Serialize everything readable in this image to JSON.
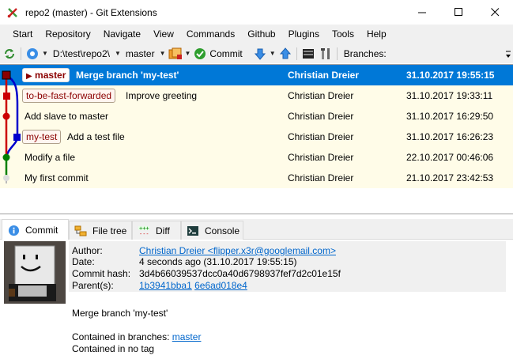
{
  "window": {
    "title": "repo2 (master) - Git Extensions"
  },
  "menu": [
    "Start",
    "Repository",
    "Navigate",
    "View",
    "Commands",
    "Github",
    "Plugins",
    "Tools",
    "Help"
  ],
  "toolbar": {
    "repo_path": "D:\\test\\repo2\\",
    "branch": "master",
    "commit_label": "Commit",
    "branches_label": "Branches:"
  },
  "commits": [
    {
      "ref": "master",
      "message": "Merge branch 'my-test'",
      "author": "Christian Dreier",
      "date": "31.10.2017 19:55:15"
    },
    {
      "ref": "to-be-fast-forwarded",
      "message": "Improve greeting",
      "author": "Christian Dreier",
      "date": "31.10.2017 19:33:11"
    },
    {
      "ref": "",
      "message": "Add slave to master",
      "author": "Christian Dreier",
      "date": "31.10.2017 16:29:50"
    },
    {
      "ref": "my-test",
      "message": "Add a test file",
      "author": "Christian Dreier",
      "date": "31.10.2017 16:26:23"
    },
    {
      "ref": "",
      "message": "Modify a file",
      "author": "Christian Dreier",
      "date": "22.10.2017 00:46:06"
    },
    {
      "ref": "",
      "message": "My first commit",
      "author": "Christian Dreier",
      "date": "21.10.2017 23:42:53"
    }
  ],
  "tabs": [
    "Commit",
    "File tree",
    "Diff",
    "Console"
  ],
  "details": {
    "author_label": "Author:",
    "author": "Christian Dreier <flipper.x3r@googlemail.com>",
    "date_label": "Date:",
    "date": "4 seconds ago (31.10.2017 19:55:15)",
    "hash_label": "Commit hash:",
    "hash": "3d4b66039537dcc0a40d6798937fef7d2c01e15f",
    "parents_label": "Parent(s):",
    "parent1": "1b3941bba1",
    "parent2": "6e6ad018e4",
    "message": "Merge branch 'my-test'",
    "contained_branches_label": "Contained in branches:",
    "contained_branch": "master",
    "contained_tag": "Contained in no tag"
  },
  "colors": {
    "selection": "#0078d7",
    "grid_bg": "#fffce8",
    "branch_red": "#cc0000",
    "branch_blue": "#0000cc",
    "branch_green": "#008000"
  },
  "icons": [
    "git-extensions-logo",
    "refresh-icon",
    "settings-gear-icon",
    "stash-icon",
    "commit-check-icon",
    "pull-arrow-icon",
    "push-arrow-icon",
    "terminal-icon",
    "tools-icon",
    "info-icon",
    "file-tree-icon",
    "diff-icon",
    "console-icon",
    "avatar-image"
  ]
}
